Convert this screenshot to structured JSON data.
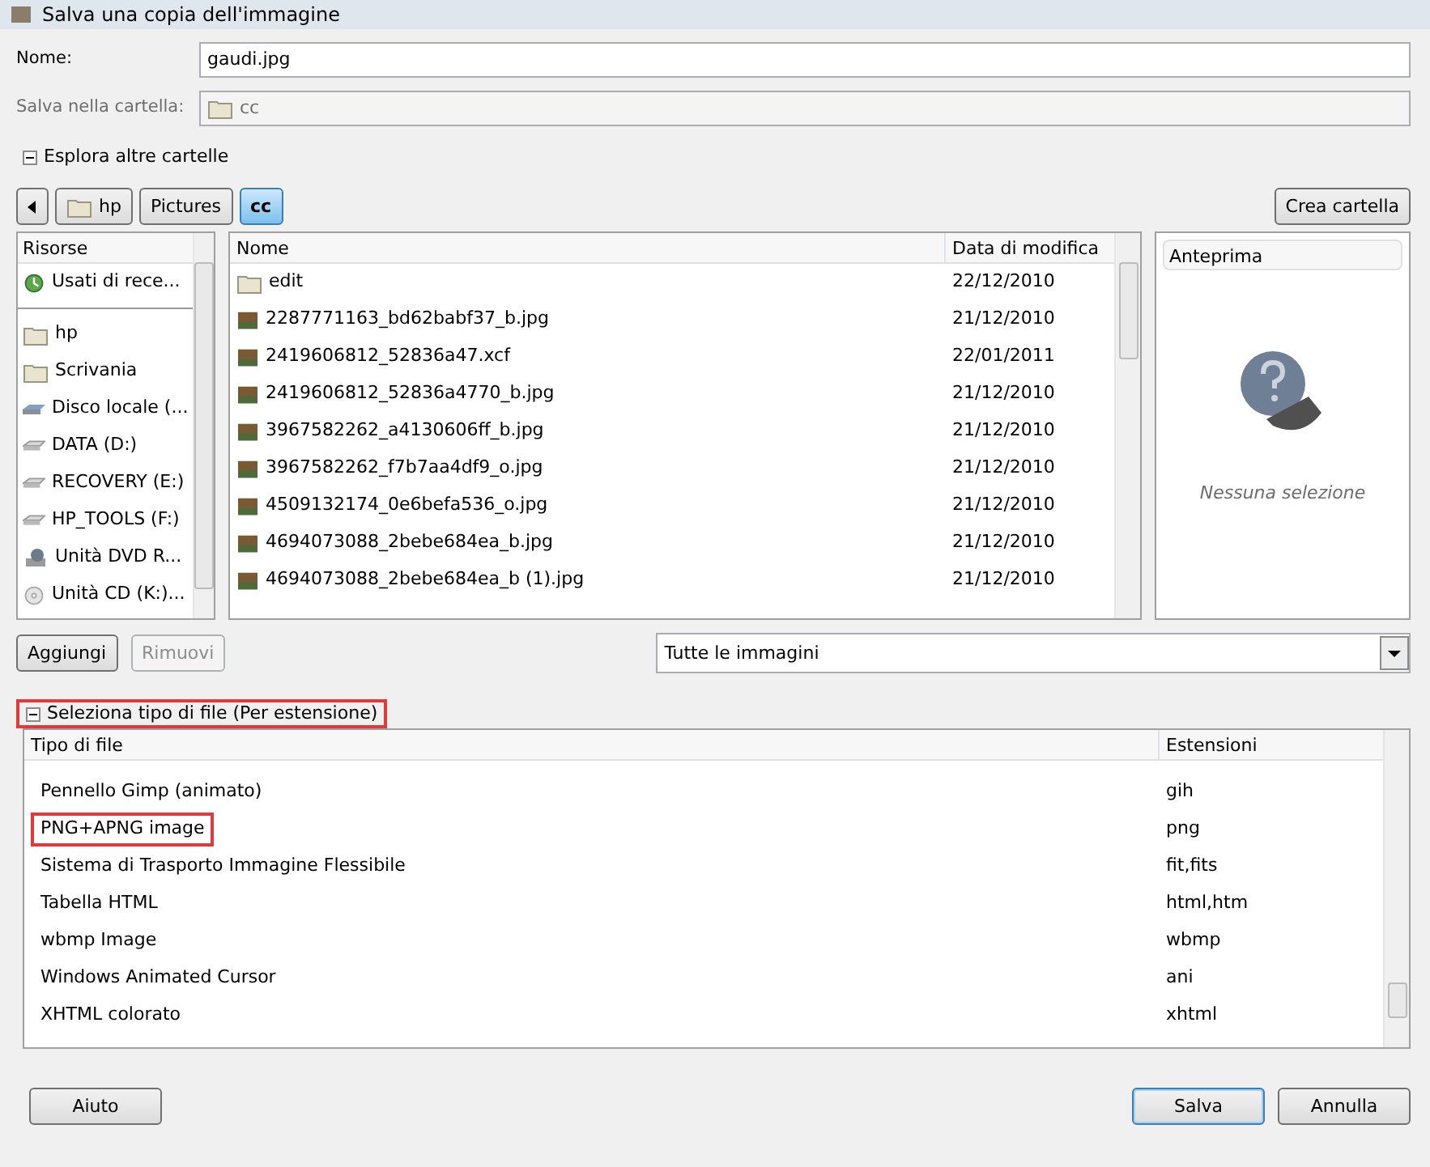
{
  "window": {
    "title": "Salva una copia dell'immagine"
  },
  "name_field": {
    "label": "Nome:",
    "value": "gaudi.jpg"
  },
  "folder_field": {
    "label": "Salva nella cartella:",
    "value": "cc",
    "disabled": true
  },
  "browse_toggle": {
    "label": "Esplora altre cartelle",
    "expanded": true
  },
  "path_bar": [
    {
      "label": "hp",
      "kind": "folder",
      "selected": false
    },
    {
      "label": "Pictures",
      "kind": "plain",
      "selected": false
    },
    {
      "label": "cc",
      "kind": "plain",
      "selected": true
    }
  ],
  "create_folder_button": "Crea cartella",
  "places": {
    "header": "Risorse",
    "items": [
      {
        "label": "Usati di rece...",
        "kind": "recent"
      },
      {
        "label": "hp",
        "kind": "folder"
      },
      {
        "label": "Scrivania",
        "kind": "folder"
      },
      {
        "label": "Disco locale (...",
        "kind": "system"
      },
      {
        "label": "DATA (D:)",
        "kind": "drive"
      },
      {
        "label": "RECOVERY (E:)",
        "kind": "drive"
      },
      {
        "label": "HP_TOOLS (F:)",
        "kind": "drive"
      },
      {
        "label": "Unità DVD R...",
        "kind": "dvd"
      },
      {
        "label": "Unità CD (K:)...",
        "kind": "cd"
      }
    ]
  },
  "files": {
    "columns": [
      "Nome",
      "Data di modifica"
    ],
    "rows": [
      {
        "name": "edit",
        "date": "22/12/2010",
        "kind": "folder"
      },
      {
        "name": "2287771163_bd62babf37_b.jpg",
        "date": "21/12/2010",
        "kind": "image"
      },
      {
        "name": "2419606812_52836a47.xcf",
        "date": "22/01/2011",
        "kind": "image"
      },
      {
        "name": "2419606812_52836a4770_b.jpg",
        "date": "21/12/2010",
        "kind": "image"
      },
      {
        "name": "3967582262_a4130606ff_b.jpg",
        "date": "21/12/2010",
        "kind": "image"
      },
      {
        "name": "3967582262_f7b7aa4df9_o.jpg",
        "date": "21/12/2010",
        "kind": "image"
      },
      {
        "name": "4509132174_0e6befa536_o.jpg",
        "date": "21/12/2010",
        "kind": "image"
      },
      {
        "name": "4694073088_2bebe684ea_b.jpg",
        "date": "21/12/2010",
        "kind": "image"
      },
      {
        "name": "4694073088_2bebe684ea_b (1).jpg",
        "date": "21/12/2010",
        "kind": "image"
      }
    ]
  },
  "preview": {
    "header": "Anteprima",
    "message": "Nessuna selezione"
  },
  "add_button": {
    "label": "Aggiungi",
    "disabled": false
  },
  "remove_button": {
    "label": "Rimuovi",
    "disabled": true
  },
  "filter": {
    "value": "Tutte le immagini"
  },
  "file_type_toggle": {
    "label": "Seleziona tipo di file (Per estensione)",
    "expanded": true,
    "highlighted": true
  },
  "file_types": {
    "columns": [
      "Tipo di file",
      "Estensioni"
    ],
    "rows": [
      {
        "type": "Pennello Gimp (animato)",
        "ext": "gih",
        "highlighted": false
      },
      {
        "type": "PNG+APNG image",
        "ext": "png",
        "highlighted": true
      },
      {
        "type": "Sistema di Trasporto Immagine Flessibile",
        "ext": "fit,fits",
        "highlighted": false
      },
      {
        "type": "Tabella HTML",
        "ext": "html,htm",
        "highlighted": false
      },
      {
        "type": "wbmp Image",
        "ext": "wbmp",
        "highlighted": false
      },
      {
        "type": "Windows Animated Cursor",
        "ext": "ani",
        "highlighted": false
      },
      {
        "type": "XHTML colorato",
        "ext": "xhtml",
        "highlighted": false
      }
    ]
  },
  "buttons": [
    {
      "label": "Aiuto",
      "kind": "help"
    },
    {
      "label": "Salva",
      "kind": "default"
    },
    {
      "label": "Annulla",
      "kind": "cancel"
    }
  ]
}
